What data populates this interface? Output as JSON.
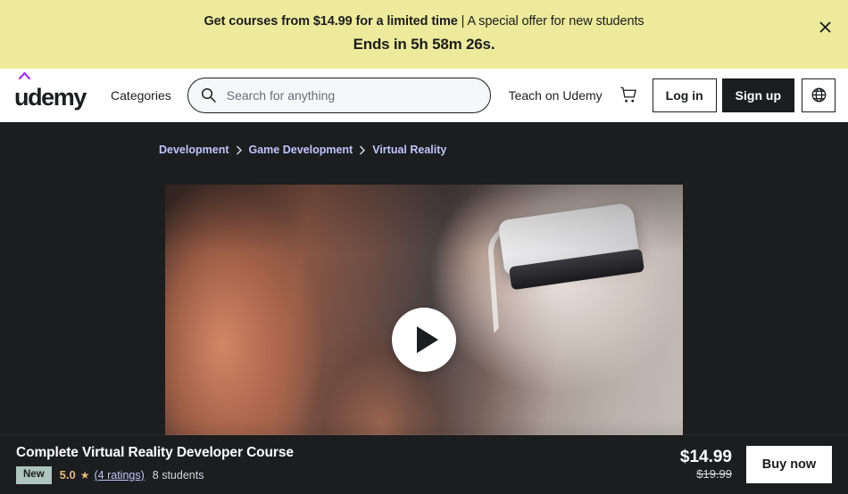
{
  "promo_banner": {
    "headline_strong": "Get courses from $14.99 for a limited time",
    "separator": " | ",
    "headline_rest": "A special offer for new students",
    "countdown": "Ends in 5h 58m 26s.",
    "close_icon": "close-icon",
    "background_color": "#edea9b",
    "text_color": "#1c1d1f"
  },
  "header": {
    "logo_text": "udemy",
    "logo_accent_color": "#a435f0",
    "categories_label": "Categories",
    "search": {
      "placeholder": "Search for anything",
      "value": "",
      "icon": "search-icon"
    },
    "teach_label": "Teach on Udemy",
    "cart_icon": "shopping-cart-icon",
    "login_label": "Log in",
    "signup_label": "Sign up",
    "language_icon": "globe-icon"
  },
  "breadcrumb": {
    "items": [
      {
        "label": "Development"
      },
      {
        "label": "Game Development"
      },
      {
        "label": "Virtual Reality"
      }
    ],
    "link_color": "#c0c4fc"
  },
  "video_preview": {
    "alt": "Person wearing a virtual reality headset reaching out with hands",
    "play_icon": "play-icon"
  },
  "sticky_bar": {
    "course_title": "Complete Virtual Reality Developer Course",
    "badge_new": "New",
    "rating_value": "5.0",
    "star_icon": "star-icon",
    "ratings_link": "(4 ratings)",
    "students": "8 students",
    "price_current": "$14.99",
    "price_original": "$19.99",
    "buy_label": "Buy now",
    "badge_color": "#adc5bc",
    "rating_color": "#e8b778"
  }
}
